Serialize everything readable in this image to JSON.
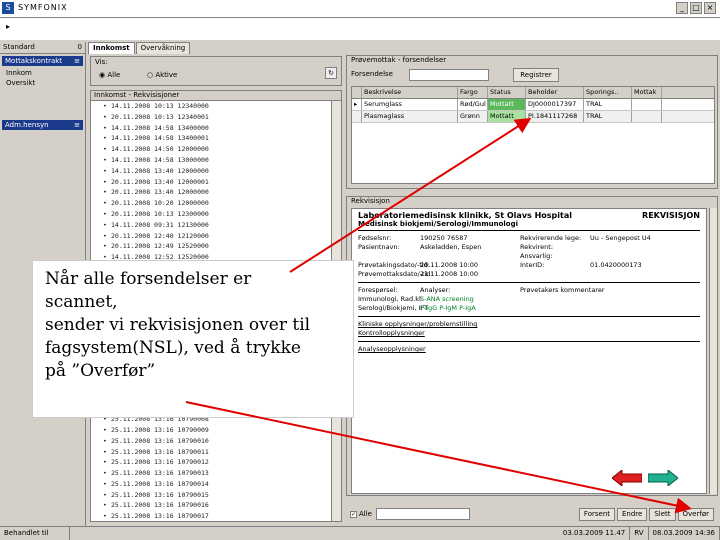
{
  "window": {
    "title": "SYMFONIX",
    "caret": "▸"
  },
  "left": {
    "header": "Standard",
    "header_count": "0",
    "group1": "Mottakskontrakt",
    "group1_badge": "≡",
    "items": [
      "Innkom",
      "Oversikt"
    ],
    "group2": "Adm.hensyn",
    "group2_badge": "≡"
  },
  "mid": {
    "tabs": [
      "Innkomst",
      "Overvåkning"
    ],
    "vis_label": "Vis:",
    "radio1": "Alle",
    "radio2": "Aktive",
    "list_title": "Innkomst - Rekvisisjoner",
    "rows": [
      "14.11.2008 10:13 12340000 ",
      "20.11.2008 10:13 12340001 ",
      "14.11.2008 14:58 13400000 ",
      "14.11.2008 14:58 13400001 ",
      "14.11.2008 14:50 12000000 ",
      "14.11.2008 14:58 13000000 ",
      "14.11.2008 13:40 12000000 ",
      "20.11.2008 13:40 12000001 ",
      "20.11.2008 13:40 12000000 ",
      "20.11.2008 10:20 12000000 ",
      "20.11.2008 10:13 12300000 ",
      "14.11.2008 09:31 12130000 ",
      "20.11.2008 12:40 12120000 ",
      "20.11.2008 12:49 12520000 ",
      "14.11.2008 12:52 12520000 ",
      "21.11.2008 20:13 10780000 ",
      "17.11.2008 09:30 12650000 ",
      "19.11.2008 12:53 12500000 ",
      "20.11.2008 12:53 12500000 ",
      "20.11.2008 12:53 12500000 ",
      "20.11.2008 12:53 12500000 ",
      "25.11.2008 13:15 10790000 ",
      "25.11.2008 13:15 10790001 ",
      "25.11.2008 13:15 10790002 ",
      "25.11.2008 13:16 10790003 ",
      "25.11.2008 13:16 10790004 ",
      "25.11.2008 13:16 10790005 ",
      "25.11.2008 13:16 10790006 ",
      "25.11.2008 13:16 10790007 ",
      "25.11.2008 13:16 10790008 ",
      "25.11.2008 13:16 10790009 ",
      "25.11.2008 13:16 10790010 ",
      "25.11.2008 13:16 10790011 ",
      "25.11.2008 13:16 10790012 ",
      "25.11.2008 13:16 10790013 ",
      "25.11.2008 13:16 10790014 ",
      "25.11.2008 13:16 10790015 ",
      "25.11.2008 13:16 10790016 ",
      "25.11.2008 13:16 10790017 ",
      "25.11.2008 13:16 10790018 ",
      "25.11.2008 13:16 10790019 "
    ],
    "red_row_index": 15
  },
  "overlay": {
    "lines": [
      "Når alle forsendelser er",
      "scannet,",
      "sender vi rekvisisjonen over til",
      "fagsystem(NSL), ved å trykke",
      "på ”Overfør”"
    ]
  },
  "panel_top": {
    "title": "Prøvemottak - forsendelser",
    "search_label": "Forsendelse",
    "search_value": "",
    "search_button": "Registrer",
    "columns": [
      "",
      "Beskrivelse",
      "Fargo",
      "Status",
      "Beholder",
      "Sporings..",
      "Mottak"
    ],
    "rows": [
      [
        "▸",
        "Serumglass",
        "Rød/Gul",
        "Mottatt",
        "DJ0000017397",
        "TRAL",
        ""
      ],
      [
        "",
        "Plasmaglass",
        "Grønn",
        "Mottatt",
        "PI.1841117268",
        "TRAL",
        ""
      ]
    ]
  },
  "panel_doc": {
    "title": "Rekvisisjon",
    "lab": "Laboratoriemedisinsk klinikk, St Olavs Hospital",
    "dept": "Medisinsk biokjemi/Serologi/Immunologi",
    "form": "REKVISISJON",
    "rows": [
      [
        "Fødselsnr:",
        "190250 76587",
        "Rekvirerende lege:",
        "Uu - Sengepost U4"
      ],
      [
        "Pasientnavn:",
        "Askeladden, Espen",
        "Rekvirent:",
        ""
      ],
      [
        "",
        "",
        "Ansvarlig:",
        ""
      ],
      [
        "Prøvetakingsdato/-tid:",
        "20.11.2008 10:00",
        "InterID:",
        "01.0420000173"
      ],
      [
        "Prøvemottaksdato/-tid:",
        "21.11.2008 10:00",
        "",
        ""
      ]
    ],
    "section_label": "Forespørsel:",
    "analyses_label": "Analyser:",
    "analysis_a": "S-ANA screening",
    "analysis_b": "P-IgG P-IgM P-IgA",
    "extra_label": "Immunologi, Rad.kl",
    "extra_label2": "Serologi/Biokjemi, IFT",
    "right_note": "Prøvetakers kommentarer",
    "line1": "Kliniske opplysninger/problemstilling",
    "line2": "Kontrollopplysninger",
    "line3": "Analyseopplysninger"
  },
  "bottom": {
    "checkbox": "Alle",
    "buttons": [
      "Forsent",
      "Endre",
      "Slett",
      "Overfør"
    ]
  },
  "status": [
    "Behandlet til mottak",
    "03.03.2009 11.47",
    "RV",
    "08.03.2009 14:36"
  ]
}
